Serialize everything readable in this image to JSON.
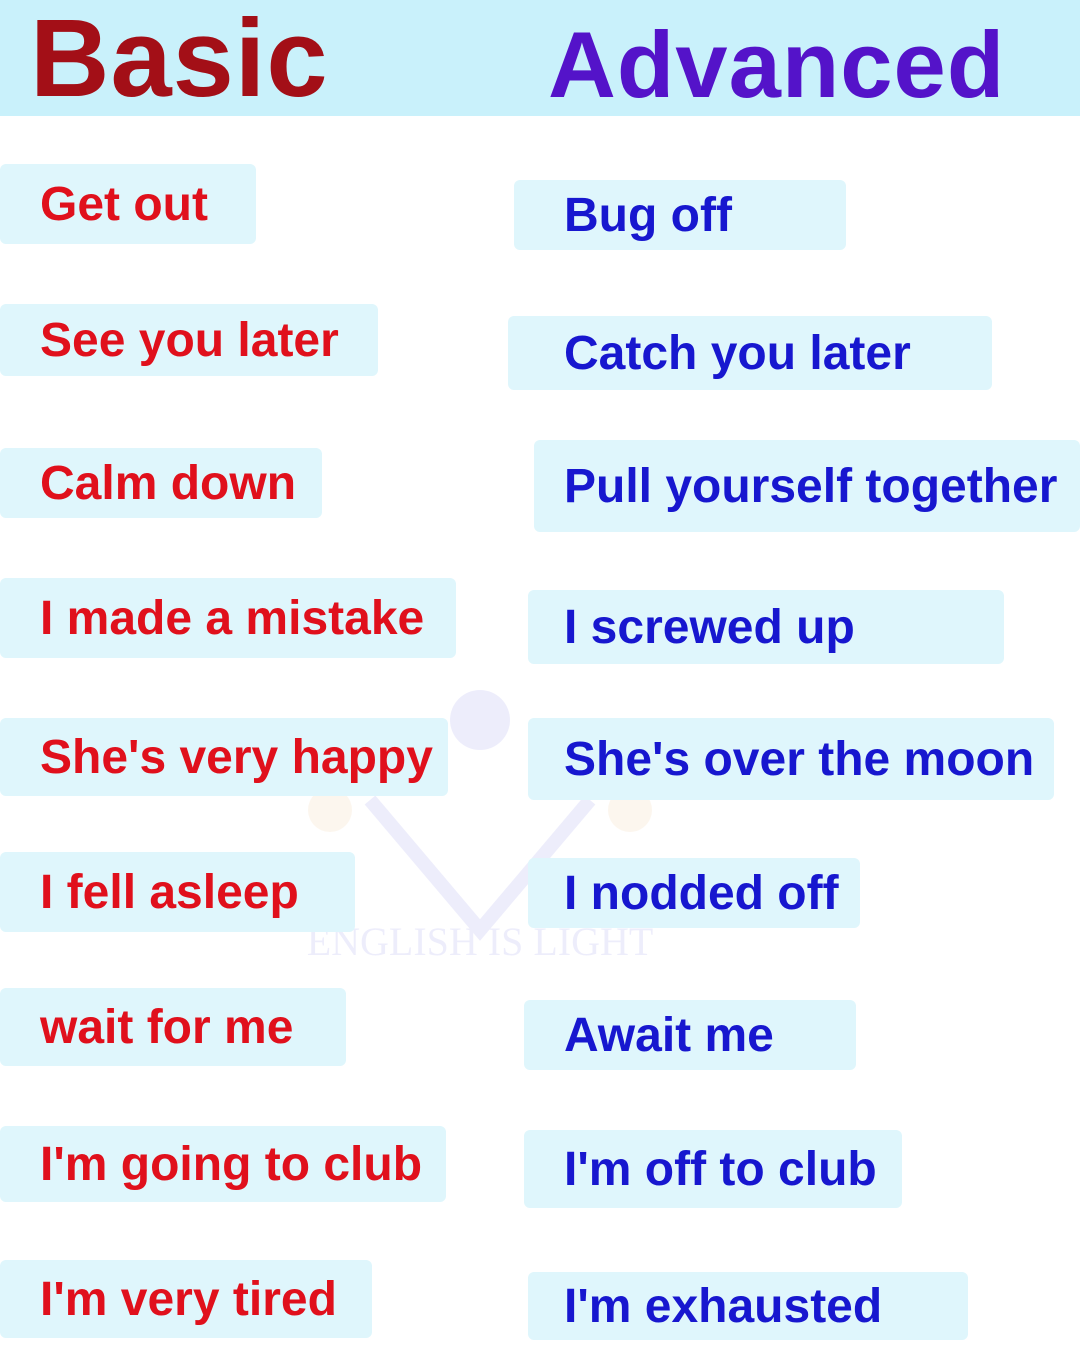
{
  "headers": {
    "basic": "Basic",
    "advanced": "Advanced"
  },
  "watermark": {
    "text": "ENGLISH IS LIGHT"
  },
  "rows": [
    {
      "basic": "Get out",
      "advanced": "Bug off"
    },
    {
      "basic": "See you later",
      "advanced": "Catch you later"
    },
    {
      "basic": "Calm down",
      "advanced": "Pull yourself together"
    },
    {
      "basic": "I made a mistake",
      "advanced": "I screwed up"
    },
    {
      "basic": "She's very happy",
      "advanced": "She's over the moon"
    },
    {
      "basic": "I fell asleep",
      "advanced": "I nodded off"
    },
    {
      "basic": "wait for me",
      "advanced": "Await me"
    },
    {
      "basic": "I'm going to club",
      "advanced": "I'm off to club"
    },
    {
      "basic": "I'm very tired",
      "advanced": "I'm exhausted"
    }
  ],
  "colors": {
    "header_bg": "#c9f1fb",
    "basic_heading": "#a30f17",
    "advanced_heading": "#5413c9",
    "basic_text": "#e0101c",
    "advanced_text": "#1717cf",
    "box_bg": "#dff6fc"
  }
}
